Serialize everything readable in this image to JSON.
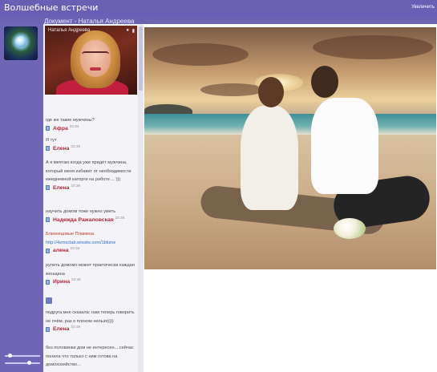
{
  "header": {
    "app_title": "Волшебные встречи",
    "right_text": "Увеличить",
    "doc_title": "Документ - Наталья Андреева"
  },
  "profile": {
    "name": "Наталья Андреева"
  },
  "messages": [
    {
      "text": "где же такие мужчины?",
      "author": "Афра",
      "time": "22:34"
    },
    {
      "text": "Я тут",
      "author": "Елена",
      "time": "22:35"
    },
    {
      "text": "А я мечтаю когда уже придёт мужчина, который меня избавит от необходимости ежедневной каторги на работе ... )))",
      "author": "Елена",
      "time": "22:35"
    },
    {
      "text": "научить домом тоже нужно уметь",
      "author": "Надежда Ражаловская",
      "time": "22:35"
    },
    {
      "text": "Близнецовые Пламена",
      "link": "http://4zmxclab.wixsite.com/1blizne",
      "author": "алена",
      "time": "22:34"
    },
    {
      "text": "рулить домомо может практически каждая женщина",
      "author": "Ирина",
      "time": "22:45"
    },
    {
      "text": "подруга мне сказала: нам теперь говорить не очём, раз о плохом нельзя))))",
      "author": "Елена",
      "time": "22:45"
    },
    {
      "text": "без половинки дом не интересен... сейчас поняла что только с ним готова на домохозяйство...",
      "author": "",
      "time": ""
    }
  ],
  "icons": {
    "doc": "document-icon",
    "like": "thumbs-up-icon",
    "pin": "pin-icon",
    "cam": "camera-icon"
  },
  "colors": {
    "topbar": "#6a5fb4",
    "author": "#b0283a",
    "link": "#2f6bd0"
  }
}
